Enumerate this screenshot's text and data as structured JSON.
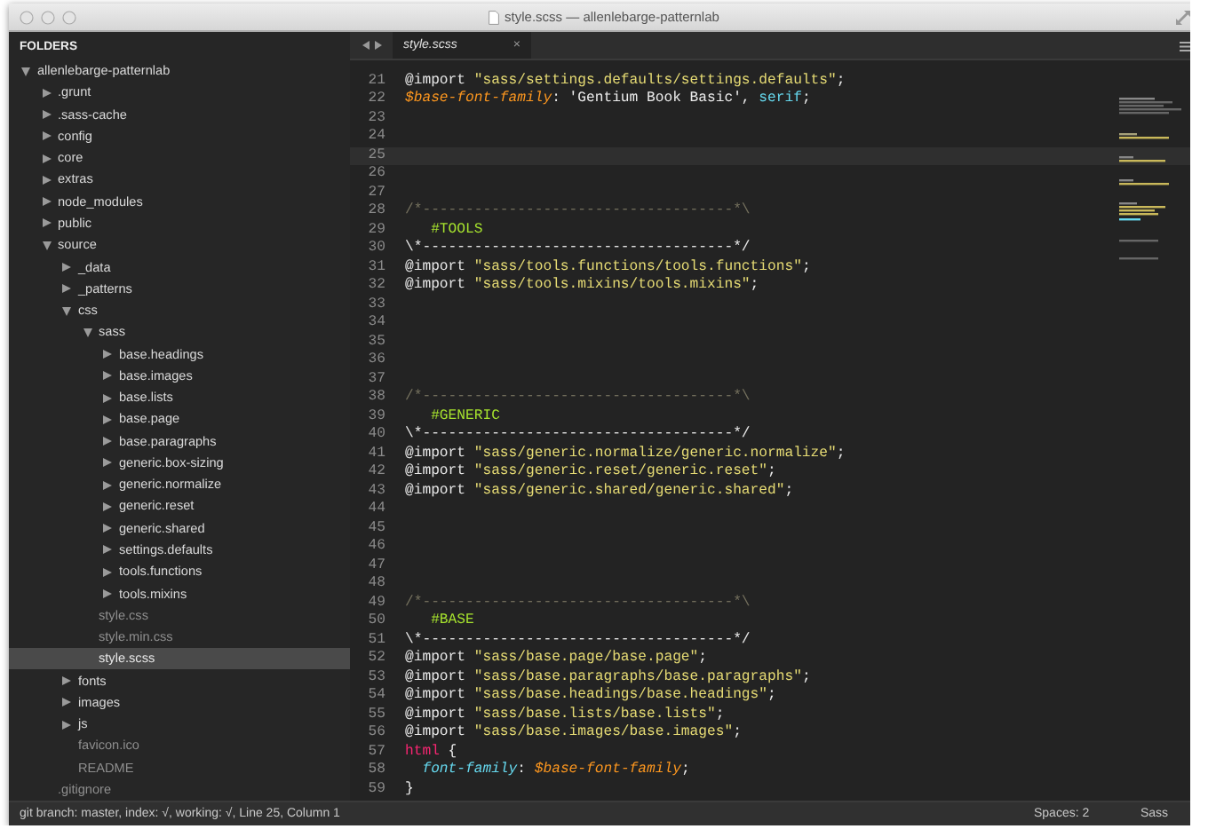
{
  "window": {
    "title": "style.scss — allenlebarge-patternlab"
  },
  "sidebar": {
    "heading": "FOLDERS",
    "tree": [
      {
        "label": "allenlebarge-patternlab",
        "kind": "folder",
        "expanded": true,
        "selected": false,
        "children": [
          {
            "label": ".grunt",
            "kind": "folder",
            "expanded": false,
            "selected": false
          },
          {
            "label": ".sass-cache",
            "kind": "folder",
            "expanded": false,
            "selected": false
          },
          {
            "label": "config",
            "kind": "folder",
            "expanded": false,
            "selected": false
          },
          {
            "label": "core",
            "kind": "folder",
            "expanded": false,
            "selected": false
          },
          {
            "label": "extras",
            "kind": "folder",
            "expanded": false,
            "selected": false
          },
          {
            "label": "node_modules",
            "kind": "folder",
            "expanded": false,
            "selected": false
          },
          {
            "label": "public",
            "kind": "folder",
            "expanded": false,
            "selected": false
          },
          {
            "label": "source",
            "kind": "folder",
            "expanded": true,
            "selected": false,
            "children": [
              {
                "label": "_data",
                "kind": "folder",
                "expanded": false,
                "selected": false
              },
              {
                "label": "_patterns",
                "kind": "folder",
                "expanded": false,
                "selected": false
              },
              {
                "label": "css",
                "kind": "folder",
                "expanded": true,
                "selected": false,
                "children": [
                  {
                    "label": "sass",
                    "kind": "folder",
                    "expanded": true,
                    "selected": false,
                    "children": [
                      {
                        "label": "base.headings",
                        "kind": "folder",
                        "expanded": false,
                        "selected": false
                      },
                      {
                        "label": "base.images",
                        "kind": "folder",
                        "expanded": false,
                        "selected": false
                      },
                      {
                        "label": "base.lists",
                        "kind": "folder",
                        "expanded": false,
                        "selected": false
                      },
                      {
                        "label": "base.page",
                        "kind": "folder",
                        "expanded": false,
                        "selected": false
                      },
                      {
                        "label": "base.paragraphs",
                        "kind": "folder",
                        "expanded": false,
                        "selected": false
                      },
                      {
                        "label": "generic.box-sizing",
                        "kind": "folder",
                        "expanded": false,
                        "selected": false
                      },
                      {
                        "label": "generic.normalize",
                        "kind": "folder",
                        "expanded": false,
                        "selected": false
                      },
                      {
                        "label": "generic.reset",
                        "kind": "folder",
                        "expanded": false,
                        "selected": false
                      },
                      {
                        "label": "generic.shared",
                        "kind": "folder",
                        "expanded": false,
                        "selected": false
                      },
                      {
                        "label": "settings.defaults",
                        "kind": "folder",
                        "expanded": false,
                        "selected": false
                      },
                      {
                        "label": "tools.functions",
                        "kind": "folder",
                        "expanded": false,
                        "selected": false
                      },
                      {
                        "label": "tools.mixins",
                        "kind": "folder",
                        "expanded": false,
                        "selected": false
                      }
                    ]
                  },
                  {
                    "label": "style.css",
                    "kind": "file",
                    "selected": false
                  },
                  {
                    "label": "style.min.css",
                    "kind": "file",
                    "selected": false
                  },
                  {
                    "label": "style.scss",
                    "kind": "file",
                    "selected": true
                  }
                ]
              },
              {
                "label": "fonts",
                "kind": "folder",
                "expanded": false,
                "selected": false
              },
              {
                "label": "images",
                "kind": "folder",
                "expanded": false,
                "selected": false
              },
              {
                "label": "js",
                "kind": "folder",
                "expanded": false,
                "selected": false
              },
              {
                "label": "favicon.ico",
                "kind": "file",
                "selected": false
              },
              {
                "label": "README",
                "kind": "file",
                "selected": false
              }
            ]
          },
          {
            "label": ".gitignore",
            "kind": "file",
            "selected": false
          }
        ]
      }
    ]
  },
  "tabs": [
    {
      "label": "style.scss",
      "close": "×",
      "selected": true
    }
  ],
  "editor": {
    "lines": [
      {
        "number": "21",
        "current": false,
        "tokens": [
          {
            "kind": "keyword",
            "text": "@import "
          },
          {
            "kind": "string",
            "text": "\"sass/settings.defaults/settings.defaults\""
          },
          {
            "kind": "plain",
            "text": ";"
          }
        ]
      },
      {
        "number": "22",
        "current": false,
        "tokens": [
          {
            "kind": "variable",
            "text": "$base-font-family"
          },
          {
            "kind": "plain",
            "text": ": 'Gentium Book Basic', "
          },
          {
            "kind": "value",
            "text": "serif"
          },
          {
            "kind": "plain",
            "text": ";"
          }
        ]
      },
      {
        "number": "23",
        "current": false
      },
      {
        "number": "24",
        "current": false
      },
      {
        "number": "25",
        "current": true
      },
      {
        "number": "26",
        "current": false
      },
      {
        "number": "27",
        "current": false
      },
      {
        "number": "28",
        "current": false,
        "tokens": [
          {
            "kind": "comment",
            "text": "/*------------------------------------*\\"
          }
        ]
      },
      {
        "number": "29",
        "current": false,
        "tokens": [
          {
            "kind": "heading",
            "text": "   #TOOLS"
          }
        ]
      },
      {
        "number": "30",
        "current": false,
        "tokens": [
          {
            "kind": "plain",
            "text": "\\*------------------------------------*/"
          }
        ]
      },
      {
        "number": "31",
        "current": false,
        "tokens": [
          {
            "kind": "keyword",
            "text": "@import "
          },
          {
            "kind": "string",
            "text": "\"sass/tools.functions/tools.functions\""
          },
          {
            "kind": "plain",
            "text": ";"
          }
        ]
      },
      {
        "number": "32",
        "current": false,
        "tokens": [
          {
            "kind": "keyword",
            "text": "@import "
          },
          {
            "kind": "string",
            "text": "\"sass/tools.mixins/tools.mixins\""
          },
          {
            "kind": "plain",
            "text": ";"
          }
        ]
      },
      {
        "number": "33",
        "current": false
      },
      {
        "number": "34",
        "current": false
      },
      {
        "number": "35",
        "current": false
      },
      {
        "number": "36",
        "current": false
      },
      {
        "number": "37",
        "current": false
      },
      {
        "number": "38",
        "current": false,
        "tokens": [
          {
            "kind": "comment",
            "text": "/*------------------------------------*\\"
          }
        ]
      },
      {
        "number": "39",
        "current": false,
        "tokens": [
          {
            "kind": "heading",
            "text": "   #GENERIC"
          }
        ]
      },
      {
        "number": "40",
        "current": false,
        "tokens": [
          {
            "kind": "plain",
            "text": "\\*------------------------------------*/"
          }
        ]
      },
      {
        "number": "41",
        "current": false,
        "tokens": [
          {
            "kind": "keyword",
            "text": "@import "
          },
          {
            "kind": "string",
            "text": "\"sass/generic.normalize/generic.normalize\""
          },
          {
            "kind": "plain",
            "text": ";"
          }
        ]
      },
      {
        "number": "42",
        "current": false,
        "tokens": [
          {
            "kind": "keyword",
            "text": "@import "
          },
          {
            "kind": "string",
            "text": "\"sass/generic.reset/generic.reset\""
          },
          {
            "kind": "plain",
            "text": ";"
          }
        ]
      },
      {
        "number": "43",
        "current": false,
        "tokens": [
          {
            "kind": "keyword",
            "text": "@import "
          },
          {
            "kind": "string",
            "text": "\"sass/generic.shared/generic.shared\""
          },
          {
            "kind": "plain",
            "text": ";"
          }
        ]
      },
      {
        "number": "44",
        "current": false
      },
      {
        "number": "45",
        "current": false
      },
      {
        "number": "46",
        "current": false
      },
      {
        "number": "47",
        "current": false
      },
      {
        "number": "48",
        "current": false
      },
      {
        "number": "49",
        "current": false,
        "tokens": [
          {
            "kind": "comment",
            "text": "/*------------------------------------*\\"
          }
        ]
      },
      {
        "number": "50",
        "current": false,
        "tokens": [
          {
            "kind": "heading",
            "text": "   #BASE"
          }
        ]
      },
      {
        "number": "51",
        "current": false,
        "tokens": [
          {
            "kind": "plain",
            "text": "\\*------------------------------------*/"
          }
        ]
      },
      {
        "number": "52",
        "current": false,
        "tokens": [
          {
            "kind": "keyword",
            "text": "@import "
          },
          {
            "kind": "string",
            "text": "\"sass/base.page/base.page\""
          },
          {
            "kind": "plain",
            "text": ";"
          }
        ]
      },
      {
        "number": "53",
        "current": false,
        "tokens": [
          {
            "kind": "keyword",
            "text": "@import "
          },
          {
            "kind": "string",
            "text": "\"sass/base.paragraphs/base.paragraphs\""
          },
          {
            "kind": "plain",
            "text": ";"
          }
        ]
      },
      {
        "number": "54",
        "current": false,
        "tokens": [
          {
            "kind": "keyword",
            "text": "@import "
          },
          {
            "kind": "string",
            "text": "\"sass/base.headings/base.headings\""
          },
          {
            "kind": "plain",
            "text": ";"
          }
        ]
      },
      {
        "number": "55",
        "current": false,
        "tokens": [
          {
            "kind": "keyword",
            "text": "@import "
          },
          {
            "kind": "string",
            "text": "\"sass/base.lists/base.lists\""
          },
          {
            "kind": "plain",
            "text": ";"
          }
        ]
      },
      {
        "number": "56",
        "current": false,
        "tokens": [
          {
            "kind": "keyword",
            "text": "@import "
          },
          {
            "kind": "string",
            "text": "\"sass/base.images/base.images\""
          },
          {
            "kind": "plain",
            "text": ";"
          }
        ]
      },
      {
        "number": "57",
        "current": false,
        "tokens": [
          {
            "kind": "tag",
            "text": "html"
          },
          {
            "kind": "plain",
            "text": " {"
          }
        ]
      },
      {
        "number": "58",
        "current": false,
        "tokens": [
          {
            "kind": "property",
            "text": "  font-family"
          },
          {
            "kind": "plain",
            "text": ": "
          },
          {
            "kind": "variable",
            "text": "$base-font-family"
          },
          {
            "kind": "plain",
            "text": ";"
          }
        ]
      },
      {
        "number": "59",
        "current": false,
        "tokens": [
          {
            "kind": "plain",
            "text": "}"
          }
        ]
      }
    ]
  },
  "status_bar": {
    "git": "git branch: master, index: √, working: √, Line 25, Column 1",
    "indentation": "Spaces: 2",
    "syntax": "Sass"
  }
}
